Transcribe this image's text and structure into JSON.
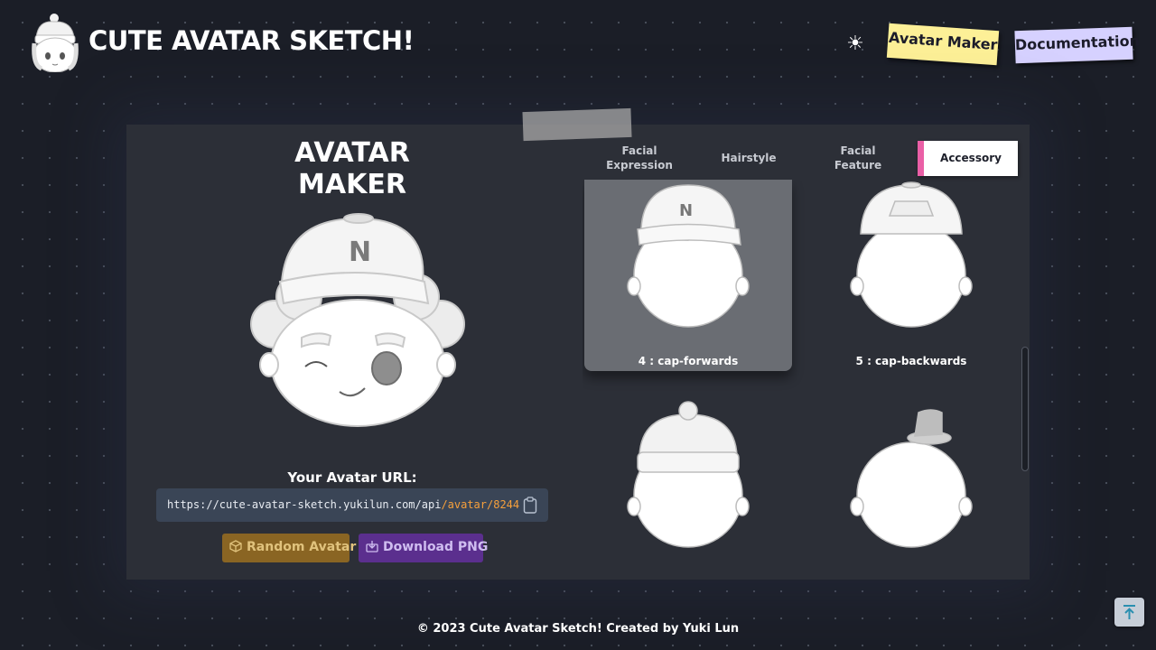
{
  "header": {
    "site_title": "CUTE AVATAR SKETCH!",
    "theme_icon": "☀",
    "nav": {
      "avatar_maker": "Avatar Maker",
      "documentation": "Documentation"
    }
  },
  "maker": {
    "title": "AVATAR MAKER",
    "url_label": "Your Avatar URL:",
    "url_base": "https://cute-avatar-sketch.yukilun.com/api",
    "url_path": "/avatar/8244",
    "random_button": "Random Avatar",
    "download_button": "Download PNG"
  },
  "tabs": [
    {
      "line1": "Facial",
      "line2": "Expression"
    },
    {
      "label": "Hairstyle"
    },
    {
      "line1": "Facial",
      "line2": "Feature"
    },
    {
      "label": "Accessory",
      "active": true
    }
  ],
  "options": [
    {
      "label": "4 : cap-forwards",
      "selected": true
    },
    {
      "label": "5 : cap-backwards",
      "selected": false
    },
    {
      "label": "",
      "selected": false
    },
    {
      "label": "",
      "selected": false
    }
  ],
  "footer": "© 2023 Cute Avatar Sketch! Created by Yuki Lun",
  "colors": {
    "background": "#1b1e27",
    "panel": "#2c2f37",
    "nav_maker": "#fdf097",
    "nav_docs": "#d6d1ff",
    "accessory_accent": "#ea5fa6",
    "url_highlight": "#f6a03c",
    "random_button": "#8a6523",
    "download_button": "#5b2f8e"
  },
  "icons": {
    "logo": "avatar-logo-icon",
    "theme": "sun-icon",
    "copy": "clipboard-icon",
    "random": "cube-icon",
    "download": "download-icon",
    "back_to_top": "arrow-up-to-line-icon"
  }
}
